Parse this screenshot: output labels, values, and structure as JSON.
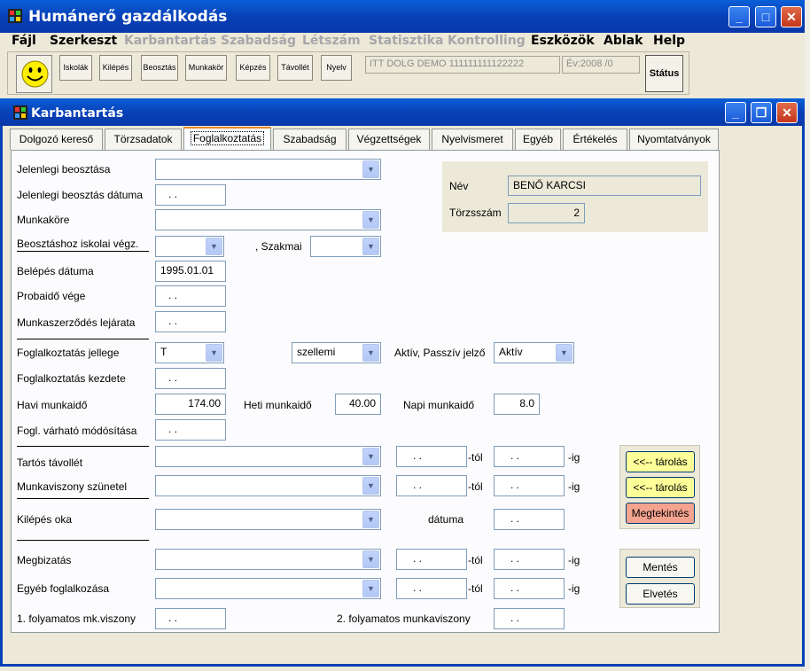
{
  "app": {
    "title": "Humánerő gazdálkodás"
  },
  "menu": [
    {
      "label": "Fájl",
      "enabled": true
    },
    {
      "label": "Szerkeszt",
      "enabled": true
    },
    {
      "label": "Karbantartás",
      "enabled": false
    },
    {
      "label": "Szabadság",
      "enabled": false
    },
    {
      "label": "Létszám",
      "enabled": false
    },
    {
      "label": "Statisztika",
      "enabled": false
    },
    {
      "label": "Kontrolling",
      "enabled": false
    },
    {
      "label": "Eszközök",
      "enabled": true
    },
    {
      "label": "Ablak",
      "enabled": true
    },
    {
      "label": "Help",
      "enabled": true
    }
  ],
  "toolbar": {
    "buttons": [
      "Iskolák",
      "Kilépés",
      "Beosztás",
      "Munkakör",
      "Képzés",
      "Távollét",
      "Nyelv"
    ],
    "demo": "ITT DOLG DEMO 111111111122222",
    "year": "Év:2008  /0",
    "status": "Státus"
  },
  "child": {
    "title": "Karbantartás"
  },
  "tabs": [
    "Dolgozó kereső",
    "Törzsadatok",
    "Foglalkoztatás",
    "Szabadság",
    "Végzettségek",
    "Nyelvismeret",
    "Egyéb",
    "Értékelés",
    "Nyomtatványok"
  ],
  "active_tab": "Foglalkoztatás",
  "form": {
    "jelenlegi_beosztasa": {
      "label": "Jelenlegi beosztása",
      "value": ""
    },
    "jelenlegi_beosztas_datuma": {
      "label": "Jelenlegi beosztás dátuma",
      "value": ". ."
    },
    "munkakore": {
      "label": "Munkaköre",
      "value": ""
    },
    "iskolai_vegz": {
      "label": "Beosztáshoz iskolai végz.",
      "value": ""
    },
    "szakmai": {
      "label": ", Szakmai",
      "value": ""
    },
    "belepes_datuma": {
      "label": "Belépés dátuma",
      "value": "1995.01.01"
    },
    "probaido_vege": {
      "label": "Probaidő vége",
      "value": ". ."
    },
    "munkaszerzodes_lejarata": {
      "label": "Munkaszerződés lejárata",
      "value": ". ."
    },
    "foglalkoztatas_jellege": {
      "label": "Foglalkoztatás jellege",
      "value": "T"
    },
    "szellemi": {
      "value": "szellemi"
    },
    "aktiv_passziv": {
      "label": "Aktív, Passzív jelző",
      "value": "Aktív"
    },
    "foglalkoztatas_kezdete": {
      "label": "Foglalkoztatás kezdete",
      "value": ". ."
    },
    "havi_munkaido": {
      "label": "Havi munkaidő",
      "value": "174.00"
    },
    "heti_munkaido": {
      "label": "Heti munkaidő",
      "value": "40.00"
    },
    "napi_munkaido": {
      "label": "Napi munkaidő",
      "value": "8.0"
    },
    "varhato_modositas": {
      "label": "Fogl. várható módósítása",
      "value": ". ."
    },
    "tartos_tavollet": {
      "label": "Tartós távollét",
      "value": "",
      "tol": ". .",
      "ig": ". ."
    },
    "munkaviszony_szunetel": {
      "label": "Munkaviszony szünetel",
      "value": "",
      "tol": ". .",
      "ig": ". ."
    },
    "kilepes_oka": {
      "label": "Kilépés oka",
      "value": "",
      "datuma_label": "dátuma",
      "datuma": ". ."
    },
    "megbizatas": {
      "label": "Megbizatás",
      "value": "",
      "tol": ". .",
      "ig": ". ."
    },
    "egyeb_foglalkozasa": {
      "label": "Egyéb foglalkozása",
      "value": "",
      "tol": ". .",
      "ig": ". ."
    },
    "folyamatos_1": {
      "label": "1. folyamatos mk.viszony",
      "value": ". ."
    },
    "folyamatos_2": {
      "label": "2. folyamatos munkaviszony",
      "value": ". ."
    },
    "tol_suffix": "-tól",
    "ig_suffix": "-ig"
  },
  "person": {
    "nev_label": "Név",
    "nev": "BENŐ KARCSI",
    "torzsszam_label": "Törzsszám",
    "torzsszam": "2"
  },
  "buttons": {
    "tarolas": "<<-- tárolás",
    "megtekintes": "Megtekintés",
    "mentes": "Mentés",
    "elvetes": "Elvetés"
  }
}
